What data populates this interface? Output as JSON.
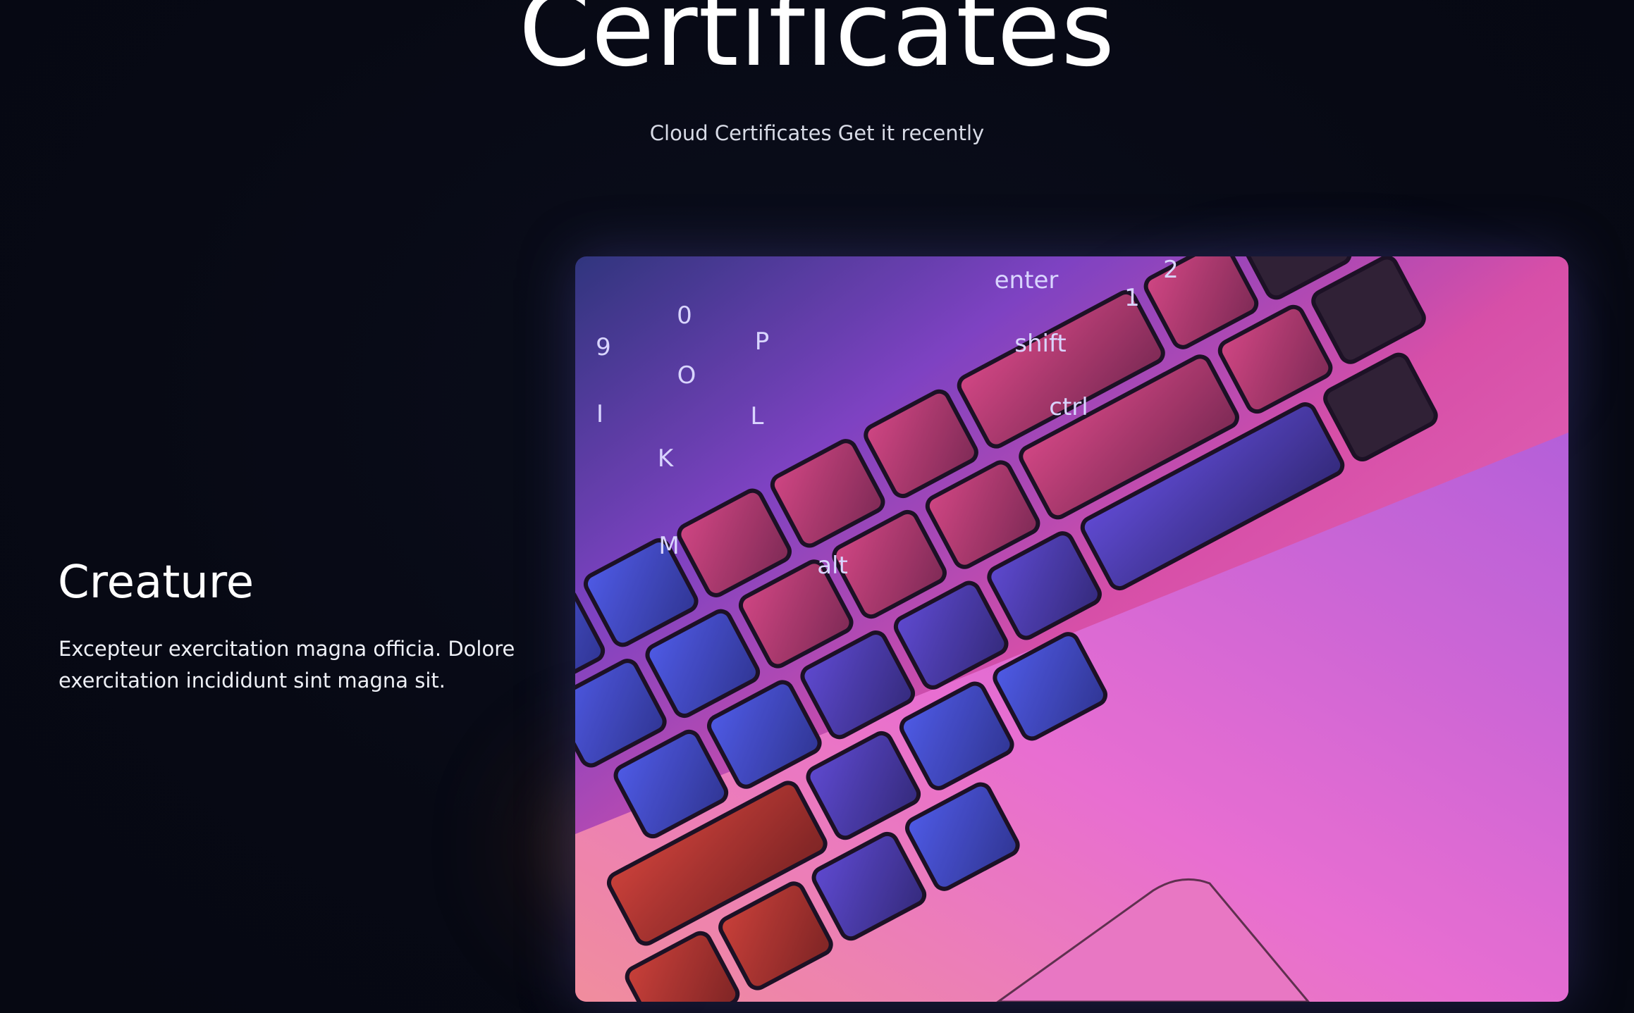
{
  "section": {
    "title": "Certificates",
    "subtitle": "Cloud Certificates Get it recently"
  },
  "card": {
    "title": "Creature",
    "description": "Excepteur exercitation magna officia. Dolore exercitation incididunt sint magna sit.",
    "image": "keyboard-photo"
  },
  "colors": {
    "background": "#070914",
    "text": "#ffffff",
    "subtitle": "#d8dbe6",
    "keyboard_blue": "#3f4be0",
    "keyboard_magenta": "#e04aa8",
    "keyboard_red": "#c0302a"
  },
  "keys": {
    "k0": "0",
    "k9": "9",
    "kP": "P",
    "kO": "O",
    "kI": "I",
    "kL": "L",
    "kK": "K",
    "kM": "M",
    "kalt": "alt",
    "kctrl": "ctrl",
    "kshift": "shift",
    "kenter": "enter",
    "k1": "1",
    "k2": "2"
  }
}
